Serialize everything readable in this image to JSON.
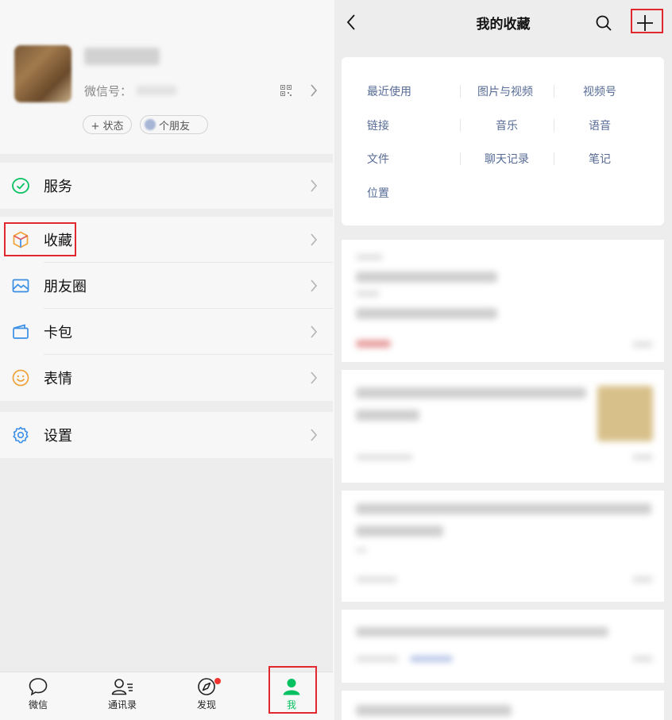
{
  "left": {
    "profile": {
      "wxid_label": "微信号：",
      "status_label": "+ 状态",
      "friends_label": "个朋友"
    },
    "menu": {
      "services": "服务",
      "favorites": "收藏",
      "moments": "朋友圈",
      "cards": "卡包",
      "stickers": "表情",
      "settings": "设置"
    },
    "tabbar": {
      "chats": "微信",
      "contacts": "通讯录",
      "discover": "发现",
      "me": "我"
    }
  },
  "right": {
    "nav": {
      "title": "我的收藏"
    },
    "categories": [
      "最近使用",
      "图片与视频",
      "视频号",
      "链接",
      "音乐",
      "语音",
      "文件",
      "聊天记录",
      "笔记",
      "位置"
    ],
    "list_items_count_visible": 5
  },
  "colors": {
    "accent_green": "#07c160",
    "link_blue": "#576b95",
    "highlight_red": "#e0282e",
    "badge_red": "#f43530"
  },
  "icons": [
    "check-circle-icon",
    "cube-icon",
    "photo-icon",
    "wallet-icon",
    "smile-icon",
    "gear-icon",
    "qr-code-icon",
    "chevron-right-icon",
    "chat-bubble-icon",
    "contacts-icon",
    "compass-icon",
    "person-icon",
    "back-arrow-icon",
    "search-icon",
    "plus-icon"
  ]
}
